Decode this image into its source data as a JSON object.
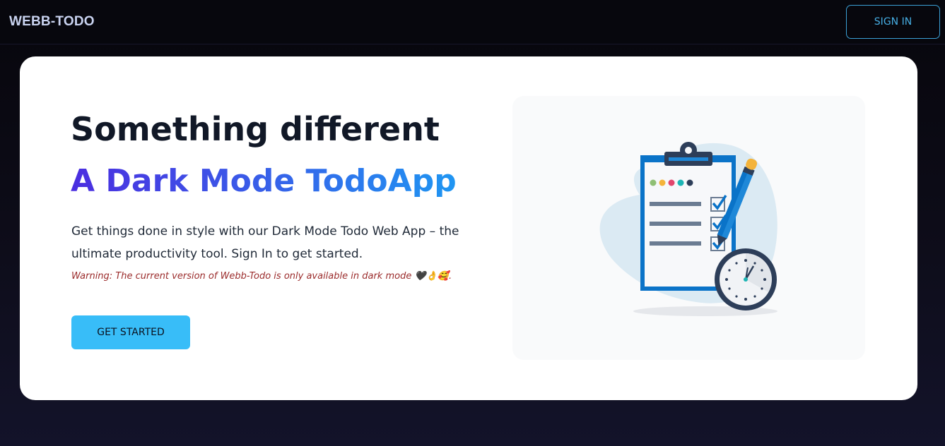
{
  "nav": {
    "brand": "WEBB-TODO",
    "signin_label": "SIGN IN"
  },
  "hero": {
    "headline": "Something different",
    "gradient_title": "A Dark Mode TodoApp",
    "description": "Get things done in style with our Dark Mode Todo Web App – the ultimate productivity tool. Sign In to get started.",
    "warning": "Warning: The current version of Webb-Todo is only available in dark mode 🖤👌🥰.",
    "cta_label": "GET STARTED"
  },
  "colors": {
    "accent": "#38bdf8",
    "signin_border": "#3ba0d6",
    "gradient_start": "#4b2ee0",
    "gradient_end": "#1f96f2",
    "warning": "#9b2c2c"
  },
  "illustration": {
    "icons": [
      "clipboard-icon",
      "pencil-icon",
      "clock-icon",
      "checkbox-icon"
    ],
    "checklist_checked": [
      true,
      true,
      true
    ]
  }
}
